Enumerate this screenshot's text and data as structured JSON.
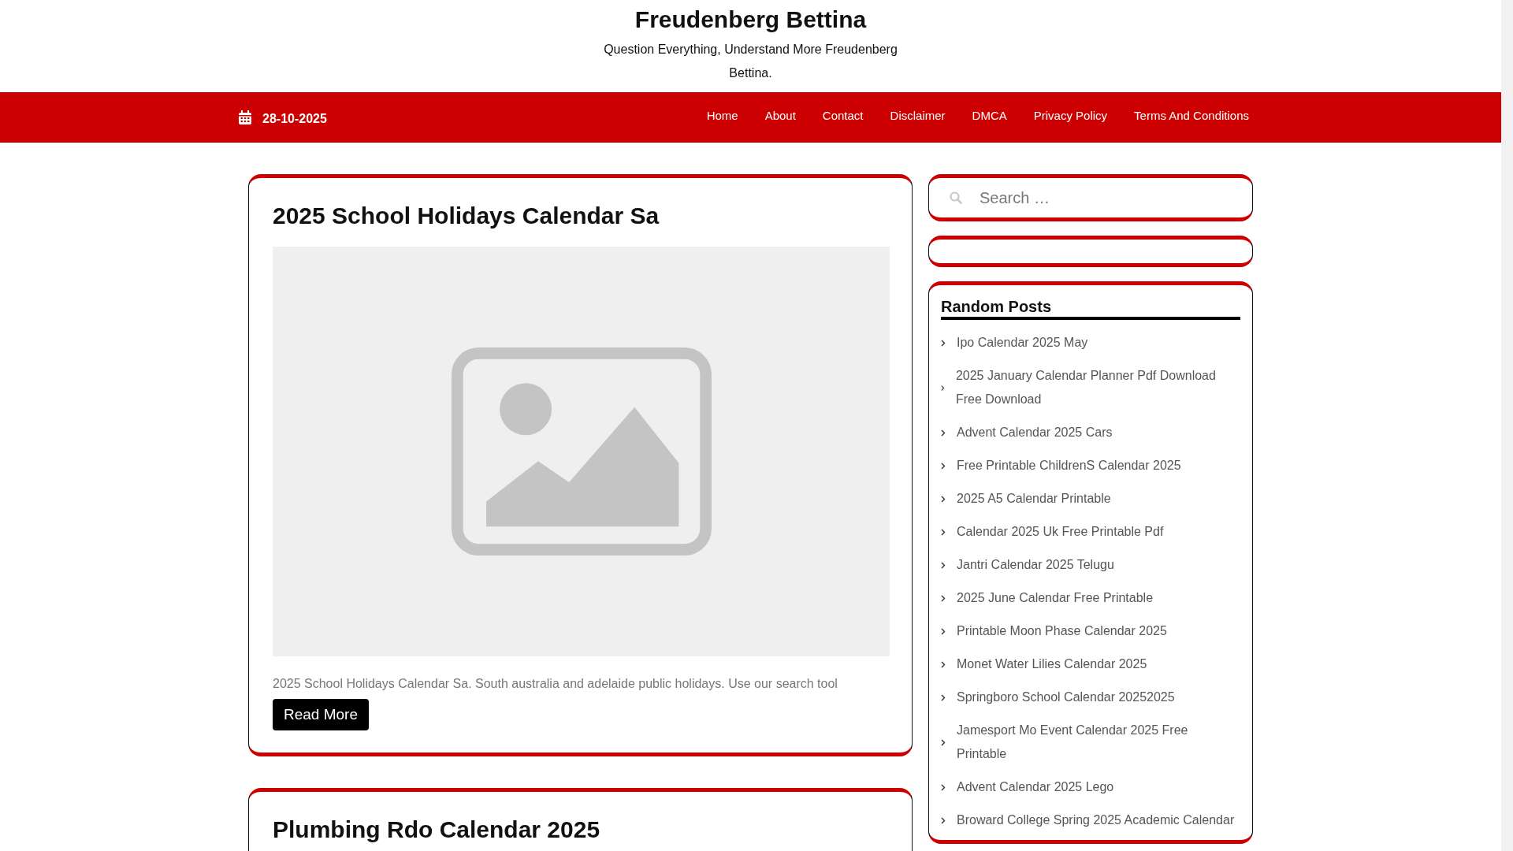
{
  "site": {
    "title": "Freudenberg Bettina",
    "tagline": "Question Everything, Understand More Freudenberg Bettina."
  },
  "nav": {
    "date": "28-10-2025",
    "links": [
      "Home",
      "About",
      "Contact",
      "Disclaimer",
      "DMCA",
      "Privacy Policy",
      "Terms And Conditions"
    ]
  },
  "posts": [
    {
      "title": "2025 School Holidays Calendar Sa",
      "image": {
        "kind": "placeholder"
      },
      "excerpt": "2025 School Holidays Calendar Sa. South australia and adelaide public holidays. Use our search tool",
      "button": "Read More"
    },
    {
      "title": "Plumbing Rdo Calendar 2025"
    }
  ],
  "sidebar": {
    "search": {
      "placeholder": "Search …"
    },
    "random_posts": {
      "title": "Random Posts",
      "items": [
        "Ipo Calendar 2025 May",
        "2025 January Calendar Planner Pdf Download Free Download",
        "Advent Calendar 2025 Cars",
        "Free Printable ChildrenS Calendar 2025",
        "2025 A5 Calendar Printable",
        "Calendar 2025 Uk Free Printable Pdf",
        "Jantri Calendar 2025 Telugu",
        "2025 June Calendar Free Printable",
        "Printable Moon Phase Calendar 2025",
        "Monet Water Lilies Calendar 2025",
        "Springboro School Calendar 20252025",
        "Jamesport Mo Event Calendar 2025 Free Printable",
        "Advent Calendar 2025 Lego",
        "Broward College Spring 2025 Academic Calendar"
      ]
    }
  }
}
